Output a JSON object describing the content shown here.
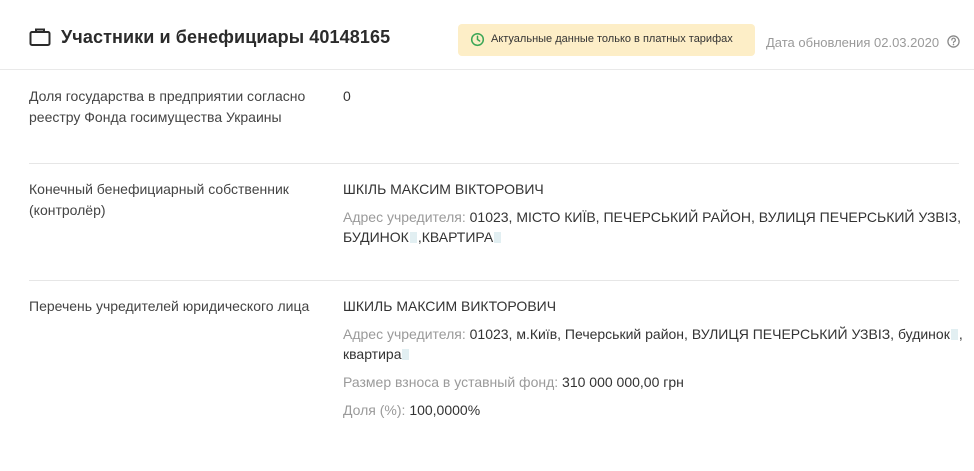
{
  "header": {
    "title": "Участники и бенефициары 40148165",
    "notice": "Актуальные данные только в платных тарифах",
    "updated": "Дата обновления 02.03.2020",
    "colors": {
      "notice_bg": "#fdeec7",
      "clock_icon": "#3aa655"
    }
  },
  "state_share": {
    "label": "Доля государства в предприятии согласно реестру Фонда госимущества Украины",
    "value": "0"
  },
  "beneficiary": {
    "label": "Конечный бенефициарный собственник (контролёр)",
    "name": "ШКІЛЬ МАКСИМ ВІКТОРОВИЧ",
    "address_label": "Адрес учредителя:",
    "address_part1": "01023, МІСТО КИЇВ, ПЕЧЕРСЬКИЙ РАЙОН, ВУЛИЦЯ ПЕЧЕРСЬКИЙ УЗВІЗ,",
    "address_part2": "БУДИНОК",
    "address_part3": ",КВАРТИРА"
  },
  "founders": {
    "label": "Перечень учредителей юридического лица",
    "name": "ШКИЛЬ МАКСИМ ВИКТОРОВИЧ",
    "address_label": "Адрес учредителя:",
    "address_part1": "01023, м.Київ, Печерський район, ВУЛИЦЯ ПЕЧЕРСЬКИЙ УЗВІЗ, будинок",
    "address_part2": ",",
    "address_part3": "квартира",
    "capital_label": "Размер взноса в уставный фонд:",
    "capital_value": "310 000 000,00 грн",
    "share_label": "Доля (%):",
    "share_value": "100,0000%"
  }
}
